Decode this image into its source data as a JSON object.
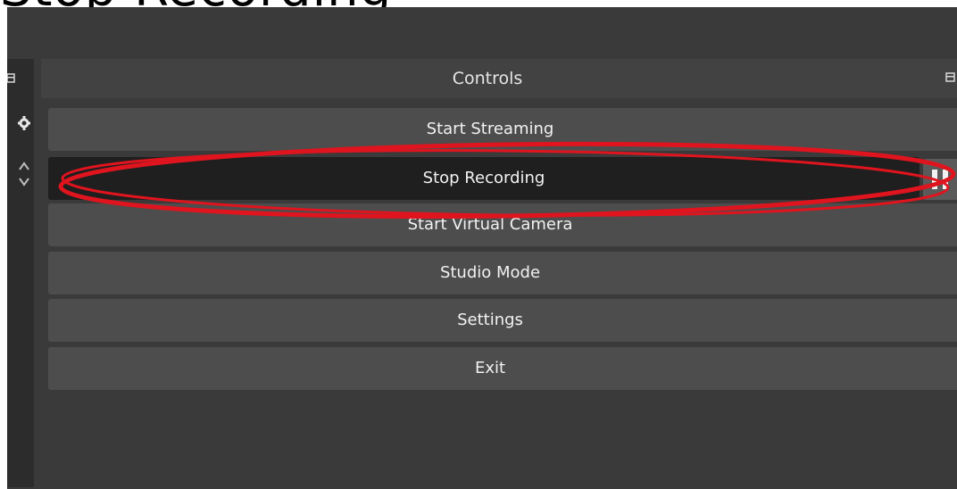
{
  "header": {
    "partial_heading": "Stop Recording"
  },
  "dock": {
    "title": "Controls"
  },
  "controls": {
    "buttons": [
      {
        "label": "Start Streaming"
      },
      {
        "label": "Stop Recording"
      },
      {
        "label": "Start Virtual Camera"
      },
      {
        "label": "Studio Mode"
      },
      {
        "label": "Settings"
      },
      {
        "label": "Exit"
      }
    ],
    "active_label": "Stop Recording"
  },
  "icons": {
    "dock_undock": "dock-float-icon",
    "gear": "gear-icon",
    "up_down": "up-down-arrow-icon",
    "pause": "pause-icon"
  },
  "colors": {
    "annotation": "#e0141e",
    "active_button": "#1f1f1f",
    "button": "#4d4d4d",
    "panel": "#3a3a3a"
  }
}
